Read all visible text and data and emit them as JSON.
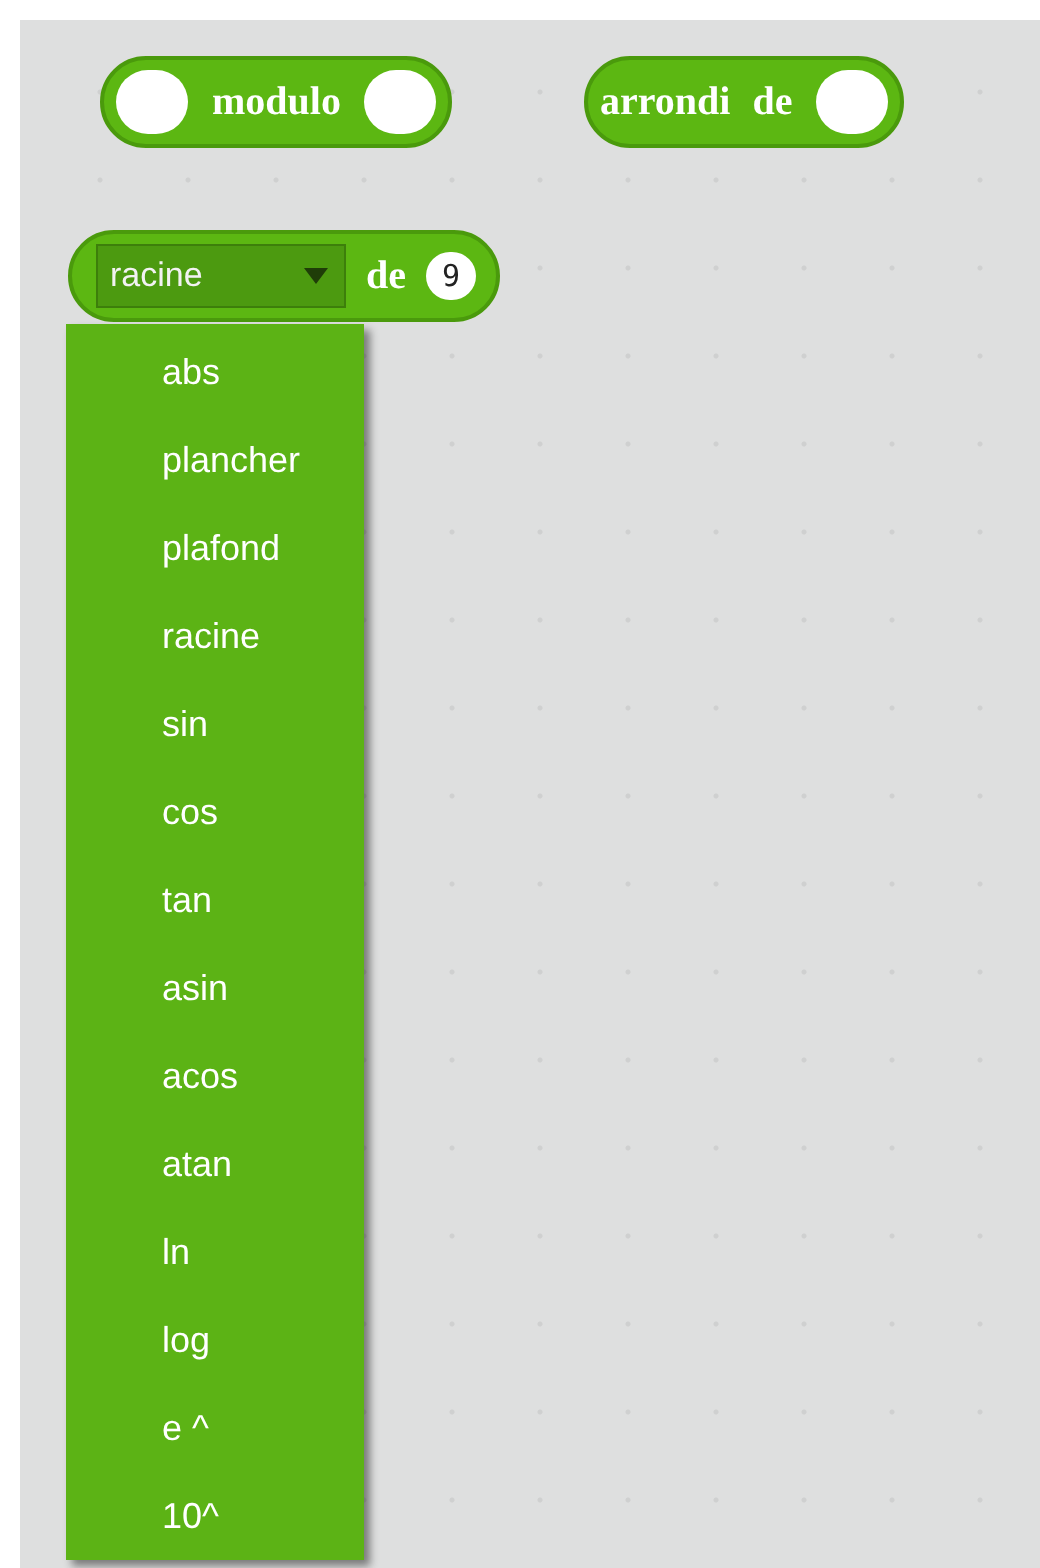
{
  "blocks": [
    {
      "kind": "binary",
      "label": "modulo"
    },
    {
      "kind": "unary",
      "label": "arrondi de"
    },
    {
      "kind": "dropdown",
      "selected_option": "racine",
      "label": "de",
      "value": "9"
    }
  ],
  "menu": {
    "options": [
      {
        "label": "abs"
      },
      {
        "label": "plancher"
      },
      {
        "label": "plafond"
      },
      {
        "label": "racine"
      },
      {
        "label": "sin"
      },
      {
        "label": "cos"
      },
      {
        "label": "tan"
      },
      {
        "label": "asin"
      },
      {
        "label": "acos"
      },
      {
        "label": "atan"
      },
      {
        "label": "ln"
      },
      {
        "label": "log"
      },
      {
        "label": "e ^"
      },
      {
        "label": "10^"
      }
    ]
  }
}
